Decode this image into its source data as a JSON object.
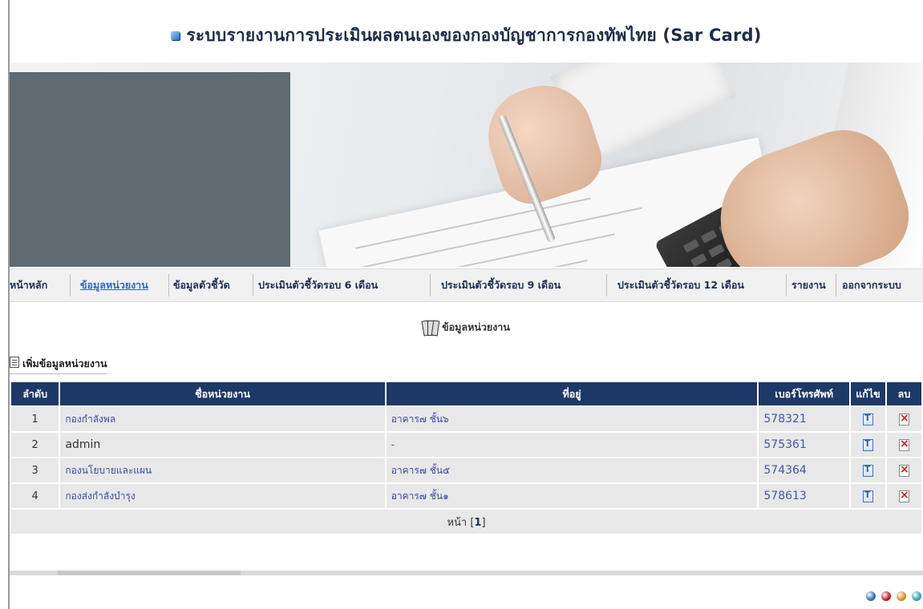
{
  "header": {
    "title": "ระบบรายงานการประเมินผลตนเองของกองบัญชาการกองทัพไทย (Sar Card)"
  },
  "nav": {
    "items": [
      {
        "label": "หน้าหลัก",
        "active": false
      },
      {
        "label": "ข้อมูลหน่วยงาน",
        "active": true
      },
      {
        "label": "ข้อมูลตัวชี้วัด",
        "active": false
      },
      {
        "label": "ประเมินตัวชี้วัดรอบ 6 เดือน",
        "active": false
      },
      {
        "label": "ประเมินตัวชี้วัดรอบ 9 เดือน",
        "active": false
      },
      {
        "label": "ประเมินตัวชี้วัดรอบ 12 เดือน",
        "active": false
      },
      {
        "label": "รายงาน",
        "active": false
      },
      {
        "label": "ออกจากระบบ",
        "active": false
      }
    ]
  },
  "section": {
    "title": "ข้อมูลหน่วยงาน",
    "add_label": "เพิ่มข้อมูลหน่วยงาน"
  },
  "table": {
    "columns": [
      "ลำดับ",
      "ชื่อหน่วยงาน",
      "ที่อยู่",
      "เบอร์โทรศัพท์",
      "แก้ไข",
      "ลบ"
    ],
    "rows": [
      {
        "no": "1",
        "name": "กองกำลังพล",
        "address": "อาคาร๗ ชั้น๖",
        "phone": "578321"
      },
      {
        "no": "2",
        "name": "admin",
        "address": "-",
        "phone": "575361"
      },
      {
        "no": "3",
        "name": "กองนโยบายและแผน",
        "address": "อาคาร๗ ชั้น๕",
        "phone": "574364"
      },
      {
        "no": "4",
        "name": "กองส่งกำลังบำรุง",
        "address": "อาคาร๗ ชั้น๑",
        "phone": "578613"
      }
    ],
    "pager": {
      "label": "หน้า",
      "current": "1"
    }
  },
  "footer": {
    "dot_colors": [
      "#2b6fb5",
      "#c8141e",
      "#e08a12",
      "#2aa6a6"
    ]
  }
}
